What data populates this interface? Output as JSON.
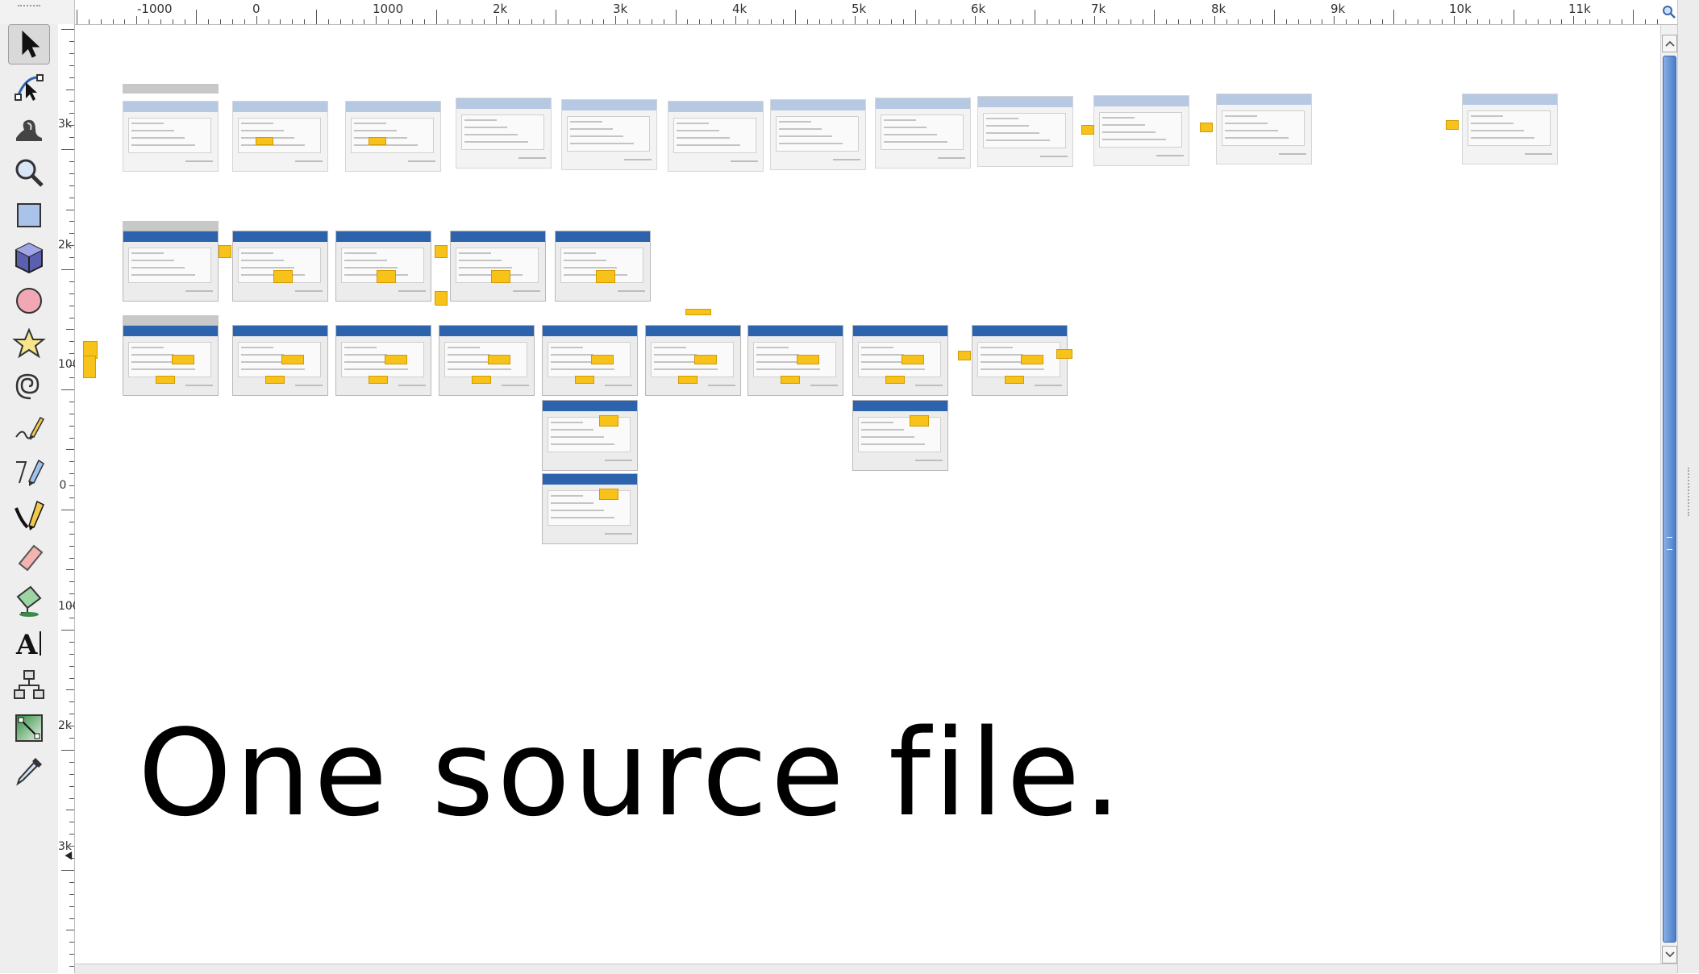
{
  "ruler": {
    "top_labels": [
      "-1000",
      "0",
      "1000",
      "2k",
      "3k",
      "4k",
      "5k",
      "6k",
      "7k",
      "8k",
      "9k",
      "10k",
      "11k"
    ],
    "left_labels": [
      "3k",
      "2k",
      "1000",
      "0",
      "1000",
      "2k",
      "3k"
    ]
  },
  "toolbox": {
    "tools": [
      {
        "name": "selector-tool",
        "icon": "arrow-cursor-icon"
      },
      {
        "name": "node-tool",
        "icon": "node-edit-icon"
      },
      {
        "name": "tweak-tool",
        "icon": "tweak-wave-icon"
      },
      {
        "name": "zoom-tool",
        "icon": "magnifier-icon"
      },
      {
        "name": "rectangle-tool",
        "icon": "rectangle-icon"
      },
      {
        "name": "3d-box-tool",
        "icon": "3d-box-icon"
      },
      {
        "name": "ellipse-tool",
        "icon": "circle-icon"
      },
      {
        "name": "star-tool",
        "icon": "star-icon"
      },
      {
        "name": "spiral-tool",
        "icon": "spiral-icon"
      },
      {
        "name": "pencil-tool",
        "icon": "pencil-icon"
      },
      {
        "name": "pen-tool",
        "icon": "pen-bezier-icon"
      },
      {
        "name": "calligraphy-tool",
        "icon": "calligraphy-nib-icon"
      },
      {
        "name": "eraser-tool",
        "icon": "eraser-icon"
      },
      {
        "name": "paint-bucket-tool",
        "icon": "paint-bucket-icon"
      },
      {
        "name": "text-tool",
        "icon": "text-A-icon"
      },
      {
        "name": "connector-tool",
        "icon": "connector-icon"
      },
      {
        "name": "gradient-tool",
        "icon": "gradient-icon"
      },
      {
        "name": "dropper-tool",
        "icon": "eyedropper-icon"
      }
    ],
    "active": "selector-tool"
  },
  "canvas": {
    "headline": "One source file."
  },
  "colors": {
    "thumb_title_bar": "#2d62ad",
    "sticky_note": "#f7c21a",
    "scroll_thumb": "#4a7cc6"
  }
}
